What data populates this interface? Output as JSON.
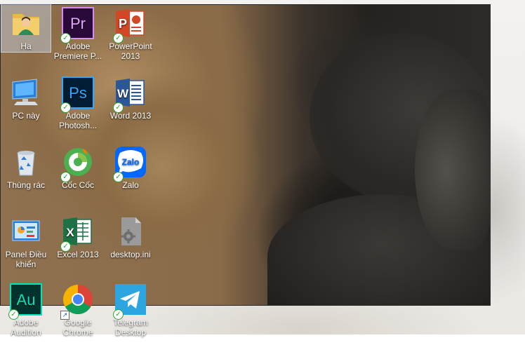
{
  "desktop": {
    "icons": [
      {
        "id": "ha",
        "label": "Ha"
      },
      {
        "id": "premiere",
        "label": "Adobe Premiere P...",
        "glyph": "Pr"
      },
      {
        "id": "powerpoint",
        "label": "PowerPoint 2013",
        "glyph": "P"
      },
      {
        "id": "pc",
        "label": "PC này"
      },
      {
        "id": "photoshop",
        "label": "Adobe Photosh...",
        "glyph": "Ps"
      },
      {
        "id": "word",
        "label": "Word 2013",
        "glyph": "W"
      },
      {
        "id": "recycle",
        "label": "Thùng rác"
      },
      {
        "id": "coccoc",
        "label": "Cốc Cốc"
      },
      {
        "id": "zalo",
        "label": "Zalo",
        "glyph": "Zalo"
      },
      {
        "id": "panel",
        "label": "Panel Điều khiển"
      },
      {
        "id": "excel",
        "label": "Excel 2013",
        "glyph": "X"
      },
      {
        "id": "desktopini",
        "label": "desktop.ini"
      },
      {
        "id": "audition",
        "label": "Adobe Audition",
        "glyph": "Au"
      },
      {
        "id": "chrome",
        "label": "Google Chrome"
      },
      {
        "id": "telegram",
        "label": "Telegram Desktop"
      }
    ]
  },
  "colors": {
    "premiere": "#2a0a3a",
    "photoshop": "#001d34",
    "audition": "#00332e",
    "powerpoint": "#d24726",
    "word": "#2b5797",
    "excel": "#1e7145",
    "zalo": "#0068ff",
    "telegram": "#2ca5e0"
  }
}
